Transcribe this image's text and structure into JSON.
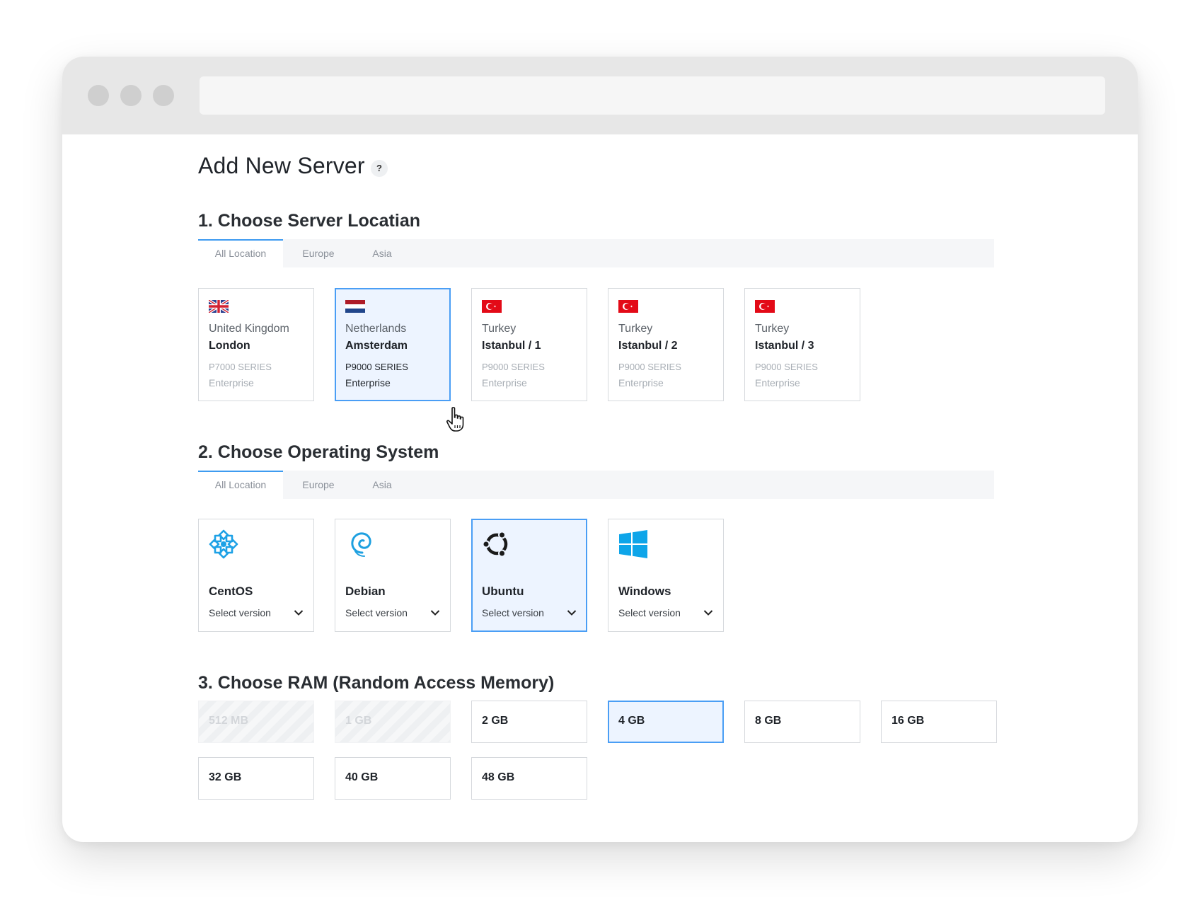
{
  "page": {
    "title": "Add New Server",
    "help_label": "?"
  },
  "sections": {
    "location": {
      "title": "1.  Choose Server Locatian"
    },
    "os": {
      "title": "2.  Choose Operating System"
    },
    "ram": {
      "title": "3.  Choose RAM (Random Access Memory)"
    }
  },
  "location_tabs": [
    {
      "label": "All Location",
      "active": true
    },
    {
      "label": "Europe",
      "active": false
    },
    {
      "label": "Asia",
      "active": false
    }
  ],
  "os_tabs": [
    {
      "label": "All Location",
      "active": true
    },
    {
      "label": "Europe",
      "active": false
    },
    {
      "label": "Asia",
      "active": false
    }
  ],
  "locations": [
    {
      "flag": "uk-flag-icon",
      "country": "United Kingdom",
      "city": "London",
      "series": "P7000 SERIES",
      "tier": "Enterprise",
      "selected": false
    },
    {
      "flag": "netherlands-flag-icon",
      "country": "Netherlands",
      "city": "Amsterdam",
      "series": "P9000 SERIES",
      "tier": "Enterprise",
      "selected": true
    },
    {
      "flag": "turkey-flag-icon",
      "country": "Turkey",
      "city": "Istanbul / 1",
      "series": "P9000 SERIES",
      "tier": "Enterprise",
      "selected": false
    },
    {
      "flag": "turkey-flag-icon",
      "country": "Turkey",
      "city": "Istanbul / 2",
      "series": "P9000 SERIES",
      "tier": "Enterprise",
      "selected": false
    },
    {
      "flag": "turkey-flag-icon",
      "country": "Turkey",
      "city": "Istanbul / 3",
      "series": "P9000 SERIES",
      "tier": "Enterprise",
      "selected": false
    }
  ],
  "operating_systems": [
    {
      "icon": "centos-logo-icon",
      "name": "CentOS",
      "version_placeholder": "Select version",
      "selected": false
    },
    {
      "icon": "debian-logo-icon",
      "name": "Debian",
      "version_placeholder": "Select version",
      "selected": false
    },
    {
      "icon": "ubuntu-logo-icon",
      "name": "Ubuntu",
      "version_placeholder": "Select version",
      "selected": true
    },
    {
      "icon": "windows-logo-icon",
      "name": "Windows",
      "version_placeholder": "Select version",
      "selected": false
    }
  ],
  "ram_options": [
    {
      "label": "512 MB",
      "state": "disabled"
    },
    {
      "label": "1 GB",
      "state": "disabled"
    },
    {
      "label": "2 GB",
      "state": "available"
    },
    {
      "label": "4 GB",
      "state": "selected"
    },
    {
      "label": "8 GB",
      "state": "available"
    },
    {
      "label": "16 GB",
      "state": "available"
    },
    {
      "label": "32 GB",
      "state": "available"
    },
    {
      "label": "40 GB",
      "state": "available"
    },
    {
      "label": "48 GB",
      "state": "available"
    }
  ],
  "colors": {
    "accent": "#4a9ef5",
    "selected_background": "#edf4ff",
    "centos": "#1da1e6",
    "debian": "#1ea0e0",
    "ubuntu": "#1a1a1a",
    "windows": "#0ea5e9",
    "flag_red": "#e30a17"
  }
}
